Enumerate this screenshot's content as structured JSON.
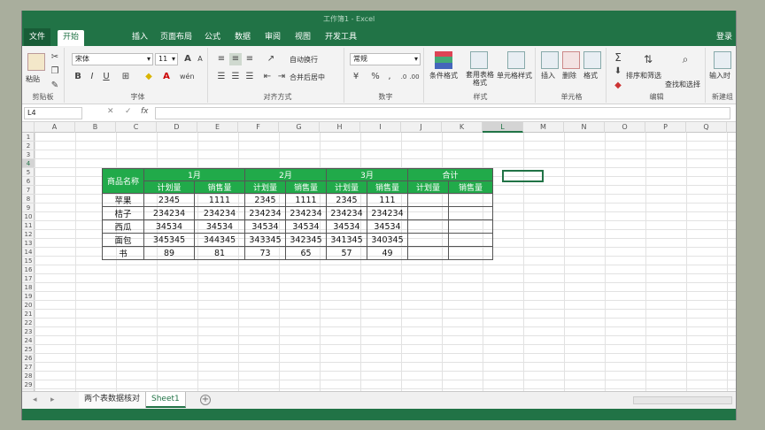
{
  "titlebar": {
    "title": "工作簿1 - Excel"
  },
  "ribbon_tabs": [
    {
      "label": "文件"
    },
    {
      "label": "开始"
    },
    {
      "label": "插入"
    },
    {
      "label": "页面布局"
    },
    {
      "label": "公式"
    },
    {
      "label": "数据"
    },
    {
      "label": "审阅"
    },
    {
      "label": "视图"
    },
    {
      "label": "开发工具"
    }
  ],
  "login_label": "登录",
  "ribbon": {
    "clipboard": {
      "paste": "粘贴",
      "label": "剪贴板"
    },
    "font": {
      "name": "宋体",
      "size": "11",
      "bold": "B",
      "italic": "I",
      "underline": "U",
      "grow": "A",
      "shrink": "A",
      "label": "字体",
      "pinyin": "wén"
    },
    "align": {
      "wrap": "自动换行",
      "merge": "合并后居中",
      "label": "对齐方式"
    },
    "number": {
      "format": "常规",
      "percent": "%",
      "comma": ",",
      "label": "数字"
    },
    "styles": {
      "cond": "条件格式",
      "table": "套用表格格式",
      "cell": "单元格样式",
      "label": "样式"
    },
    "cells": {
      "insert": "插入",
      "delete": "删除",
      "format": "格式",
      "label": "单元格"
    },
    "editing": {
      "sum": "Σ",
      "sort": "排序和筛选",
      "find": "查找和选择",
      "label": "编辑"
    },
    "newgroup": {
      "input": "输入时",
      "label": "新建组"
    }
  },
  "formula_bar": {
    "name_box": "L4",
    "fx": "fx",
    "cancel": "✕",
    "enter": "✓"
  },
  "columns": [
    "A",
    "B",
    "C",
    "D",
    "E",
    "F",
    "G",
    "H",
    "I",
    "J",
    "K",
    "L",
    "M",
    "N",
    "O",
    "P",
    "Q"
  ],
  "selected_column": "L",
  "rows": [
    "1",
    "2",
    "3",
    "4",
    "5",
    "6",
    "7",
    "8",
    "9",
    "10",
    "11",
    "12",
    "13",
    "14",
    "15",
    "16",
    "17",
    "18",
    "19",
    "20",
    "21",
    "22",
    "23",
    "24",
    "25",
    "26",
    "27",
    "28",
    "29"
  ],
  "selected_row": "4",
  "table": {
    "corner": "商品名称",
    "months": [
      "1月",
      "2月",
      "3月",
      "合计"
    ],
    "subheaders": [
      "计划量",
      "销售量",
      "计划量",
      "销售量",
      "计划量",
      "销售量",
      "计划量",
      "销售量"
    ],
    "rows": [
      {
        "name": "苹果",
        "values": [
          "2345",
          "1111",
          "2345",
          "1111",
          "2345",
          "111",
          "",
          ""
        ]
      },
      {
        "name": "桔子",
        "values": [
          "234234",
          "234234",
          "234234",
          "234234",
          "234234",
          "234234",
          "",
          ""
        ]
      },
      {
        "name": "西瓜",
        "values": [
          "34534",
          "34534",
          "34534",
          "34534",
          "34534",
          "34534",
          "",
          ""
        ]
      },
      {
        "name": "面包",
        "values": [
          "345345",
          "344345",
          "343345",
          "342345",
          "341345",
          "340345",
          "",
          ""
        ]
      },
      {
        "name": "书",
        "values": [
          "89",
          "81",
          "73",
          "65",
          "57",
          "49",
          "",
          ""
        ]
      }
    ]
  },
  "sheet_tabs": [
    {
      "label": "两个表数据核对",
      "active": false
    },
    {
      "label": "Sheet1",
      "active": true
    }
  ],
  "add_sheet": "+",
  "colors": {
    "excel_green": "#217346",
    "header_green": "#21aa4a"
  }
}
